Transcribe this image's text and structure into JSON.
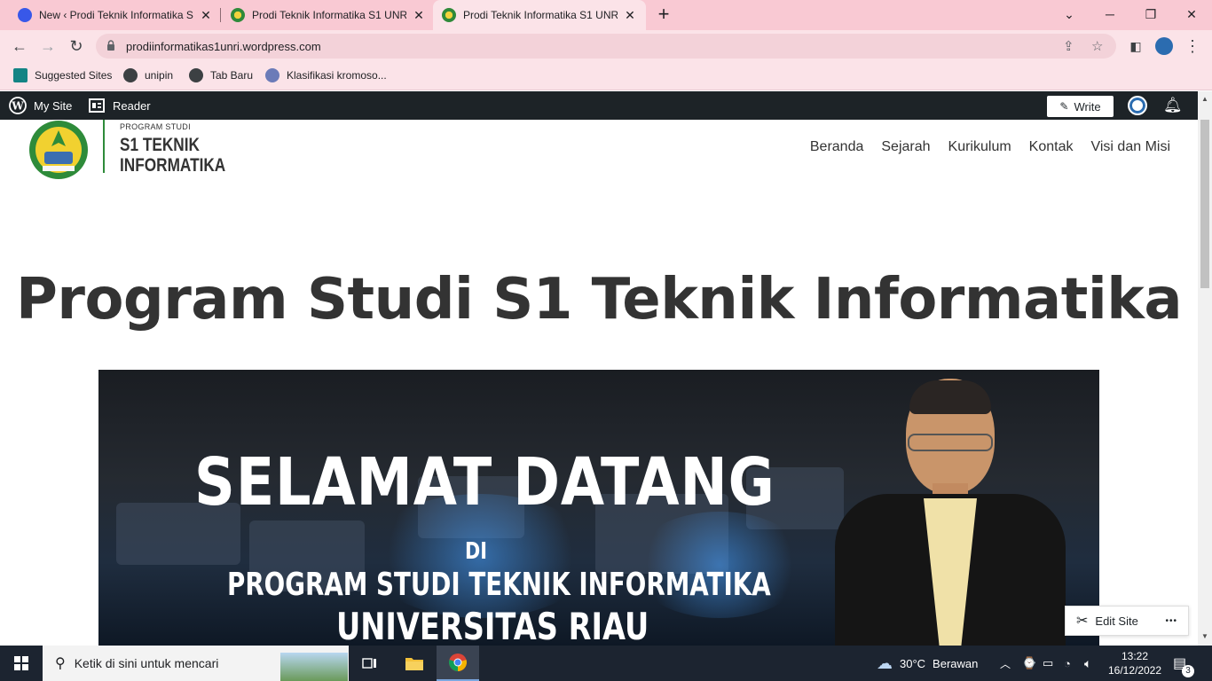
{
  "browser": {
    "tabs": [
      {
        "title": "New ‹ Prodi Teknik Informatika S",
        "close": "✕",
        "favicon": "wordpress-icon"
      },
      {
        "title": "Prodi Teknik Informatika S1 UNRI",
        "close": "✕",
        "favicon": "unri-logo-icon"
      },
      {
        "title": "Prodi Teknik Informatika S1 UNRI",
        "close": "✕",
        "favicon": "unri-logo-icon",
        "active": true
      }
    ],
    "new_tab": "+",
    "url": "prodiinformatikas1unri.wordpress.com",
    "bookmarks": [
      {
        "label": "Suggested Sites",
        "icon": "bing-icon"
      },
      {
        "label": "unipin",
        "icon": "globe-icon"
      },
      {
        "label": "Tab Baru",
        "icon": "globe-icon"
      },
      {
        "label": "Klasifikasi kromoso...",
        "icon": "site-icon"
      }
    ]
  },
  "adminbar": {
    "my_site": "My Site",
    "reader": "Reader",
    "write": "Write"
  },
  "site": {
    "logo_small": "PROGRAM STUDI",
    "logo_line1": "S1 TEKNIK",
    "logo_line2": "INFORMATIKA",
    "nav": [
      "Beranda",
      "Sejarah",
      "Kurikulum",
      "Kontak",
      "Visi dan Misi"
    ],
    "title": "Program Studi S1 Teknik Informatika",
    "hero": {
      "line1": "SELAMAT DATANG",
      "line2": "DI",
      "line3": "PROGRAM STUDI TEKNIK INFORMATIKA",
      "line4": "UNIVERSITAS RIAU"
    },
    "edit_site": "Edit Site",
    "more": "•••"
  },
  "taskbar": {
    "search_placeholder": "Ketik di sini untuk mencari",
    "weather_temp": "30°C",
    "weather_text": "Berawan",
    "time": "13:22",
    "date": "16/12/2022",
    "notifications": "3"
  },
  "colors": {
    "tabstrip": "#f9c9d3",
    "toolbar": "#fbe3e8",
    "adminbar": "#1d2327",
    "taskbar": "#1c2430",
    "logo_green": "#2e8b3a"
  }
}
